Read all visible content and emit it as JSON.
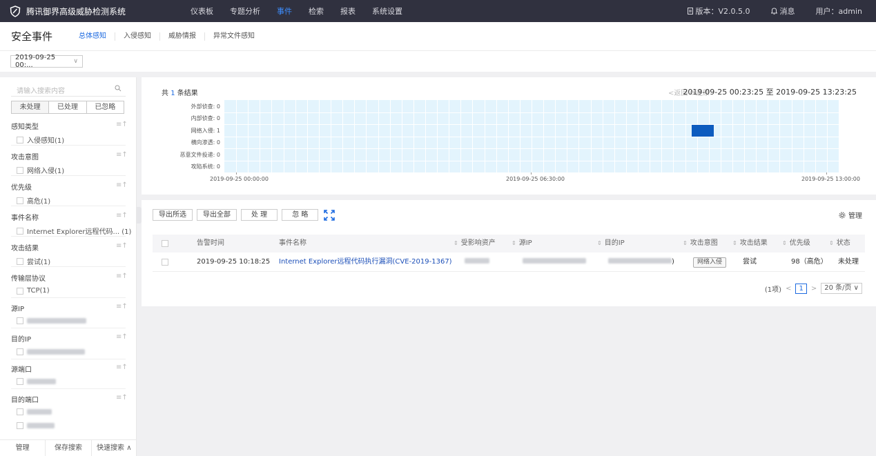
{
  "app": {
    "title": "腾讯御界高级威胁检测系统",
    "nav": [
      "仪表板",
      "专题分析",
      "事件",
      "检索",
      "报表",
      "系统设置"
    ],
    "active_nav": "事件",
    "version": "版本：V2.0.5.0",
    "messages": "消息",
    "user": "用户：admin"
  },
  "subheader": {
    "title": "安全事件",
    "tabs": [
      "总体感知",
      "入侵感知",
      "威胁情报",
      "异常文件感知"
    ]
  },
  "time_filter": {
    "value": "2019-09-25 00:...",
    "chevron": "∨"
  },
  "sidebar": {
    "search_placeholder": "请输入搜索内容",
    "status_tabs": [
      "未处理",
      "已处理",
      "已忽略"
    ],
    "groups": [
      {
        "title": "感知类型",
        "items": [
          "入侵感知(1)"
        ]
      },
      {
        "title": "攻击意图",
        "items": [
          "网络入侵(1)"
        ]
      },
      {
        "title": "优先级",
        "items": [
          "高危(1)"
        ]
      },
      {
        "title": "事件名称",
        "items": [
          "Internet Explorer远程代码...  (1)"
        ]
      },
      {
        "title": "攻击结果",
        "items": [
          "尝试(1)"
        ]
      },
      {
        "title": "传输层协议",
        "items": [
          "TCP(1)"
        ]
      },
      {
        "title": "源IP",
        "items": []
      },
      {
        "title": "目的IP",
        "items": []
      },
      {
        "title": "源端口",
        "items": []
      },
      {
        "title": "目的端口",
        "items": []
      }
    ],
    "group_icon": "≡↑",
    "footer": [
      "管理",
      "保存搜索",
      "快速搜索 ∧"
    ]
  },
  "timeline": {
    "count_prefix": "共",
    "count": "1",
    "count_suffix": "条结果",
    "nav": "<返回  ⟳还原",
    "range": "2019-09-25 00:23:25 至 2019-09-25 13:23:25",
    "rows": [
      "外部侦查: 0",
      "内部侦查: 0",
      "网络入侵: 1",
      "横向渗透: 0",
      "恶意文件投递: 0",
      "攻陷系统: 0"
    ],
    "x_labels": [
      "2019-09-25 00:00:00",
      "2019-09-25 06:30:00",
      "2019-09-25 13:00:00"
    ],
    "event": {
      "row": "网络入侵",
      "count": 1,
      "time_approx": "2019-09-25 10:18:25"
    },
    "colors": {
      "plot_bg": "#e3f4fd",
      "event": "#0d5cbf"
    }
  },
  "table": {
    "buttons": [
      "导出所选",
      "导出全部",
      "处 理",
      "忽 略"
    ],
    "manage": "管理",
    "columns": [
      "告警时间",
      "事件名称",
      "受影响资产",
      "源IP",
      "目的IP",
      "攻击意图",
      "攻击结果",
      "优先级",
      "状态"
    ],
    "rows": [
      {
        "time": "2019-09-25 10:18:25",
        "name": "Internet Explorer远程代码执行漏洞(CVE-2019-1367)",
        "dest_ip_tail": ")",
        "intent": "网络入侵",
        "result": "尝试",
        "priority": "98（高危）",
        "status": "未处理"
      }
    ],
    "pager": {
      "total": "(1项)",
      "prev": "<",
      "page": "1",
      "next": ">",
      "size": "20 条/页 ∨"
    }
  }
}
